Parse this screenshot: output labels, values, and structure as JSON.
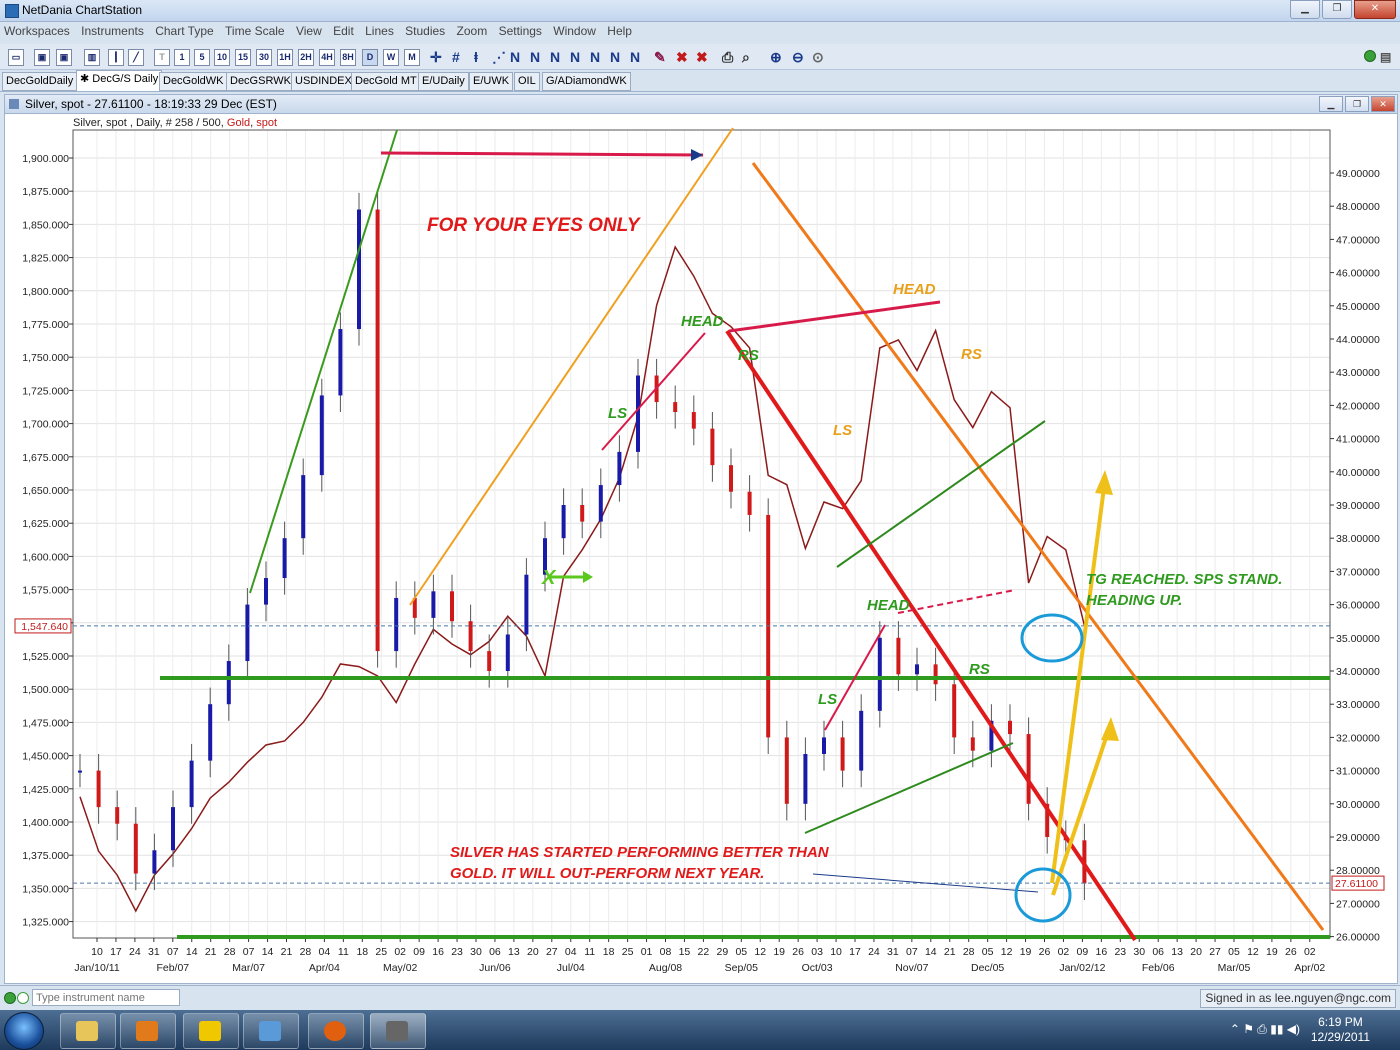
{
  "window": {
    "title": "NetDania ChartStation"
  },
  "menu": [
    "Workspaces",
    "Instruments",
    "Chart Type",
    "Time Scale",
    "View",
    "Edit",
    "Lines",
    "Studies",
    "Zoom",
    "Settings",
    "Window",
    "Help"
  ],
  "toolbar": {
    "timeframes": [
      "T",
      "1",
      "5",
      "10",
      "15",
      "30",
      "1H",
      "2H",
      "4H",
      "8H",
      "D",
      "W",
      "M"
    ]
  },
  "tabs": [
    "DecGoldDaily",
    "DecG/S Daily",
    "DecGoldWK",
    "DecGSRWK",
    "USDINDEX",
    "DecGold MT",
    "E/UDaily",
    "E/UWK",
    "OIL",
    "G/ADiamondWK"
  ],
  "active_tab": 1,
  "chart_window": {
    "title": "Silver, spot - 27.61100 - 18:19:33  29 Dec (EST)",
    "legend_prefix": "Silver, spot , Daily, # 258 / 500, ",
    "legend_gold": "Gold",
    "legend_sep": ", ",
    "legend_spot": "spot"
  },
  "chart_data": {
    "type": "line",
    "series": [
      {
        "name": "Silver, spot",
        "color": "#1a1aa8"
      },
      {
        "name": "Gold, spot",
        "color": "#8b1a1a"
      }
    ],
    "left_axis": {
      "ticks": [
        "1,325.000",
        "1,350.000",
        "1,375.000",
        "1,400.000",
        "1,425.000",
        "1,450.000",
        "1,475.000",
        "1,500.000",
        "1,525.000",
        "1,550.000",
        "1,575.000",
        "1,600.000",
        "1,625.000",
        "1,650.000",
        "1,675.000",
        "1,700.000",
        "1,725.000",
        "1,750.000",
        "1,775.000",
        "1,800.000",
        "1,825.000",
        "1,850.000",
        "1,875.000",
        "1,900.000"
      ],
      "current": "1,547.640"
    },
    "right_axis": {
      "ticks": [
        "26.00000",
        "27.00000",
        "28.00000",
        "29.00000",
        "30.00000",
        "31.00000",
        "32.00000",
        "33.00000",
        "34.00000",
        "35.00000",
        "36.00000",
        "37.00000",
        "38.00000",
        "39.00000",
        "40.00000",
        "41.00000",
        "42.00000",
        "43.00000",
        "44.00000",
        "45.00000",
        "46.00000",
        "47.00000",
        "48.00000",
        "49.00000"
      ],
      "current": "27.61100"
    },
    "x_days": [
      "10",
      "17",
      "24",
      "31",
      "07",
      "14",
      "21",
      "28",
      "07",
      "14",
      "21",
      "28",
      "04",
      "11",
      "18",
      "25",
      "02",
      "09",
      "16",
      "23",
      "30",
      "06",
      "13",
      "20",
      "27",
      "04",
      "11",
      "18",
      "25",
      "01",
      "08",
      "15",
      "22",
      "29",
      "05",
      "12",
      "19",
      "26",
      "03",
      "10",
      "17",
      "24",
      "31",
      "07",
      "14",
      "21",
      "28",
      "05",
      "12",
      "19",
      "26",
      "02",
      "09",
      "16",
      "23",
      "30",
      "06",
      "13",
      "20",
      "27",
      "05",
      "12",
      "19",
      "26",
      "02"
    ],
    "x_months": [
      "Jan/10/11",
      "Feb/07",
      "Mar/07",
      "Apr/04",
      "May/02",
      "Jun/06",
      "Jul/04",
      "Aug/08",
      "Sep/05",
      "Oct/03",
      "Nov/07",
      "Dec/05",
      "Jan/02/12",
      "Feb/06",
      "Mar/05",
      "Apr/02"
    ],
    "silver_curve": [
      [
        0,
        31.0
      ],
      [
        1,
        29.9
      ],
      [
        2,
        29.4
      ],
      [
        3,
        27.9
      ],
      [
        4,
        28.6
      ],
      [
        5,
        29.9
      ],
      [
        6,
        31.3
      ],
      [
        7,
        33.0
      ],
      [
        8,
        34.3
      ],
      [
        9,
        36.0
      ],
      [
        10,
        36.8
      ],
      [
        11,
        38.0
      ],
      [
        12,
        39.9
      ],
      [
        13,
        42.3
      ],
      [
        14,
        44.3
      ],
      [
        15,
        47.9
      ],
      [
        16,
        34.6
      ],
      [
        17,
        36.2
      ],
      [
        18,
        35.6
      ],
      [
        19,
        36.4
      ],
      [
        20,
        35.5
      ],
      [
        21,
        34.6
      ],
      [
        22,
        34.0
      ],
      [
        23,
        35.1
      ],
      [
        24,
        36.9
      ],
      [
        25,
        38.0
      ],
      [
        26,
        39.0
      ],
      [
        27,
        38.5
      ],
      [
        28,
        39.6
      ],
      [
        29,
        40.6
      ],
      [
        30,
        42.9
      ],
      [
        31,
        42.1
      ],
      [
        32,
        41.8
      ],
      [
        33,
        41.3
      ],
      [
        34,
        40.2
      ],
      [
        35,
        39.4
      ],
      [
        36,
        38.7
      ],
      [
        37,
        32.0
      ],
      [
        38,
        30.0
      ],
      [
        39,
        31.5
      ],
      [
        40,
        32.0
      ],
      [
        41,
        31.0
      ],
      [
        42,
        32.8
      ],
      [
        43,
        35.0
      ],
      [
        44,
        33.9
      ],
      [
        45,
        34.2
      ],
      [
        46,
        33.6
      ],
      [
        47,
        32.0
      ],
      [
        48,
        31.6
      ],
      [
        49,
        32.5
      ],
      [
        50,
        32.1
      ],
      [
        51,
        30.0
      ],
      [
        52,
        29.0
      ],
      [
        53,
        28.9
      ],
      [
        54,
        27.6
      ]
    ],
    "gold_curve": [
      [
        0,
        1419
      ],
      [
        1,
        1378
      ],
      [
        2,
        1360
      ],
      [
        3,
        1333
      ],
      [
        4,
        1360
      ],
      [
        5,
        1376
      ],
      [
        6,
        1395
      ],
      [
        7,
        1418
      ],
      [
        8,
        1430
      ],
      [
        9,
        1445
      ],
      [
        10,
        1458
      ],
      [
        11,
        1461
      ],
      [
        12,
        1475
      ],
      [
        13,
        1494
      ],
      [
        14,
        1519
      ],
      [
        15,
        1517
      ],
      [
        16,
        1510
      ],
      [
        17,
        1490
      ],
      [
        18,
        1519
      ],
      [
        19,
        1545
      ],
      [
        20,
        1534
      ],
      [
        21,
        1526
      ],
      [
        22,
        1536
      ],
      [
        23,
        1555
      ],
      [
        24,
        1540
      ],
      [
        25,
        1510
      ],
      [
        26,
        1585
      ],
      [
        27,
        1605
      ],
      [
        28,
        1628
      ],
      [
        29,
        1659
      ],
      [
        30,
        1705
      ],
      [
        31,
        1789
      ],
      [
        32,
        1833
      ],
      [
        33,
        1811
      ],
      [
        34,
        1783
      ],
      [
        35,
        1773
      ],
      [
        36,
        1757
      ],
      [
        37,
        1661
      ],
      [
        38,
        1654
      ],
      [
        39,
        1606
      ],
      [
        40,
        1641
      ],
      [
        41,
        1636
      ],
      [
        42,
        1657
      ],
      [
        43,
        1757
      ],
      [
        44,
        1763
      ],
      [
        45,
        1740
      ],
      [
        46,
        1770
      ],
      [
        47,
        1718
      ],
      [
        48,
        1697
      ],
      [
        49,
        1724
      ],
      [
        50,
        1712
      ],
      [
        51,
        1580
      ],
      [
        52,
        1615
      ],
      [
        53,
        1605
      ],
      [
        54,
        1548
      ]
    ]
  },
  "annotations": {
    "eyes_only": "FOR YOUR EYES ONLY",
    "head_left": "HEAD",
    "rs_left": "RS",
    "ls_left": "LS",
    "head_orange": "HEAD",
    "rs_orange": "RS",
    "ls_orange": "LS",
    "head_low": "HEAD",
    "rs_low": "RS",
    "ls_low": "LS",
    "x_mark": "X",
    "tg_line1": "TG REACHED. SPS STAND.",
    "tg_line2": "HEADING UP.",
    "silver_line1": "SILVER HAS STARTED PERFORMING BETTER THAN",
    "silver_line2": "GOLD. IT WILL OUT-PERFORM NEXT YEAR."
  },
  "statusbar": {
    "instrument_placeholder": "Type instrument name",
    "signed_in": "Signed in as lee.nguyen@ngc.com"
  },
  "taskbar": {
    "time": "6:19 PM",
    "date": "12/29/2011"
  }
}
